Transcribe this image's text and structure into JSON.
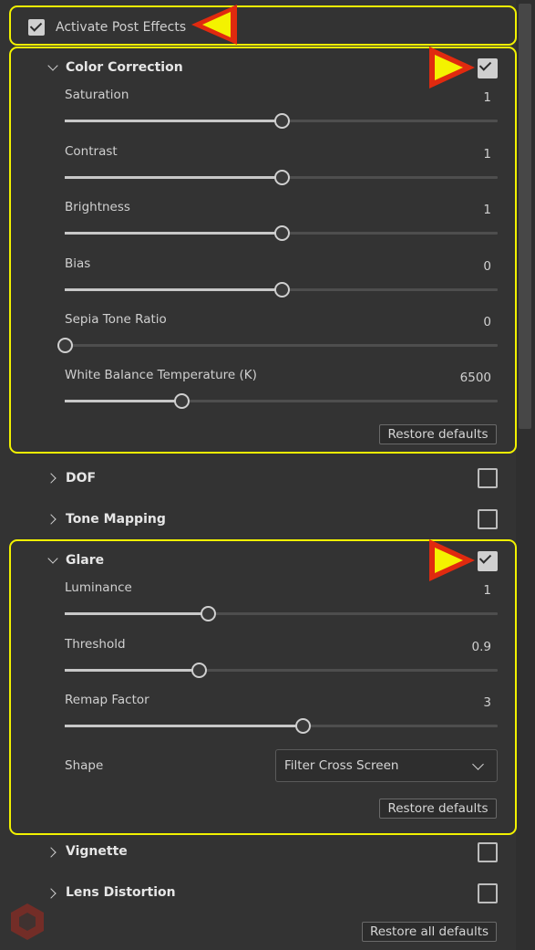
{
  "activate": {
    "label": "Activate Post Effects",
    "checked": true
  },
  "color_correction": {
    "title": "Color Correction",
    "enabled": true,
    "sliders": [
      {
        "label": "Saturation",
        "value": "1",
        "fraction": 0.5
      },
      {
        "label": "Contrast",
        "value": "1",
        "fraction": 0.5
      },
      {
        "label": "Brightness",
        "value": "1",
        "fraction": 0.5
      },
      {
        "label": "Bias",
        "value": "0",
        "fraction": 0.5
      },
      {
        "label": "Sepia Tone Ratio",
        "value": "0",
        "fraction": 0.0
      },
      {
        "label": "White Balance Temperature (K)",
        "value": "6500",
        "fraction": 0.27
      }
    ],
    "restore_label": "Restore defaults"
  },
  "dof": {
    "title": "DOF",
    "enabled": false
  },
  "tone_mapping": {
    "title": "Tone Mapping",
    "enabled": false
  },
  "glare": {
    "title": "Glare",
    "enabled": true,
    "sliders": [
      {
        "label": "Luminance",
        "value": "1",
        "fraction": 0.33
      },
      {
        "label": "Threshold",
        "value": "0.9",
        "fraction": 0.31
      },
      {
        "label": "Remap Factor",
        "value": "3",
        "fraction": 0.55
      }
    ],
    "shape_label": "Shape",
    "shape_value": "Filter Cross Screen",
    "restore_label": "Restore defaults"
  },
  "vignette": {
    "title": "Vignette",
    "enabled": false
  },
  "lens_distortion": {
    "title": "Lens Distortion",
    "enabled": false
  },
  "restore_all_label": "Restore all defaults",
  "colors": {
    "highlight": "#f2f200",
    "arrow_fill": "#f4f200",
    "arrow_border": "#e02a0f",
    "logo": "#c0392b"
  }
}
